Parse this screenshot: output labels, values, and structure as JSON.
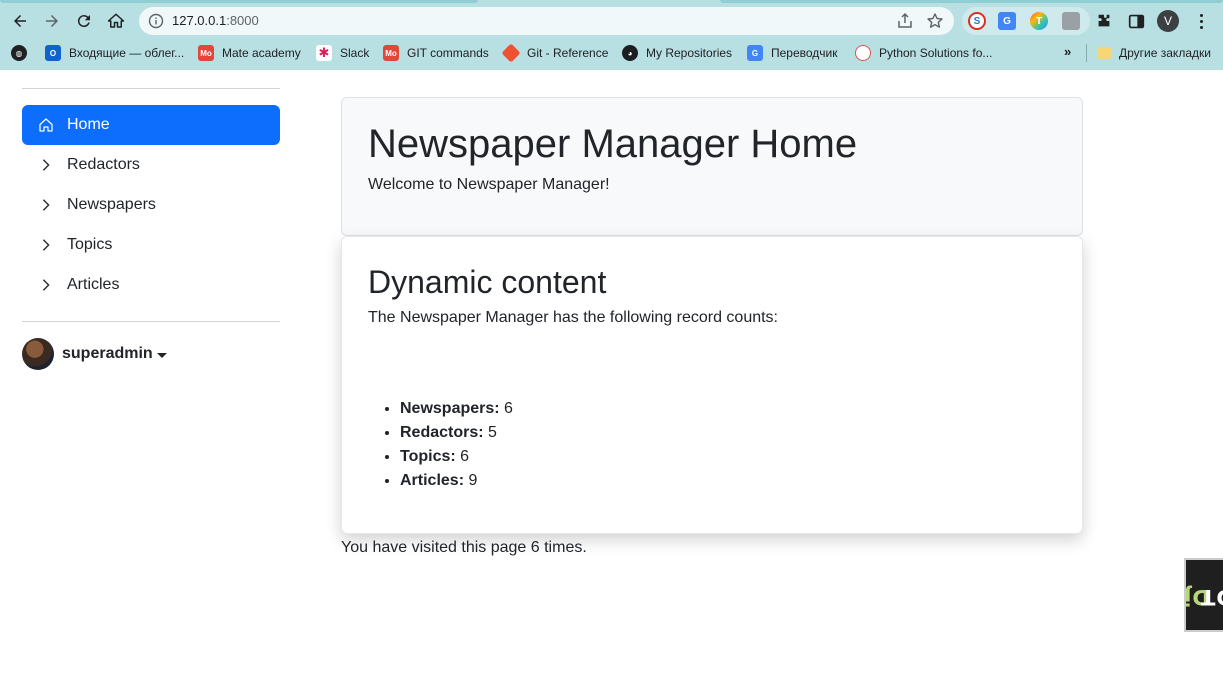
{
  "browser": {
    "url_host": "127.0.0.1",
    "url_port": ":8000",
    "profile_initial": "V",
    "bookmarks": [
      {
        "label": "Входящие — облег...",
        "icon": "outlook-icon",
        "color": "#0f64c8"
      },
      {
        "label": "Mate academy",
        "icon": "mate-academy-icon",
        "color": "#e0483c"
      },
      {
        "label": "Slack",
        "icon": "slack-icon",
        "color": "#4a154b"
      },
      {
        "label": "GIT commands",
        "icon": "git-commands-icon",
        "color": "#e0483c"
      },
      {
        "label": "Git - Reference",
        "icon": "git-icon",
        "color": "#f05133"
      },
      {
        "label": "My Repositories",
        "icon": "github-icon",
        "color": "#1b1f23"
      },
      {
        "label": "Переводчик",
        "icon": "google-translate-icon",
        "color": "#4285f4"
      },
      {
        "label": "Python Solutions fo...",
        "icon": "python-solutions-icon",
        "color": "#d9534f"
      }
    ],
    "bookmarks_more": "»",
    "other_bookmarks": "Другие закладки"
  },
  "sidebar": {
    "items": [
      {
        "label": "Home",
        "icon": "home-icon"
      },
      {
        "label": "Redactors",
        "icon": "chevron-right-icon"
      },
      {
        "label": "Newspapers",
        "icon": "chevron-right-icon"
      },
      {
        "label": "Topics",
        "icon": "chevron-right-icon"
      },
      {
        "label": "Articles",
        "icon": "chevron-right-icon"
      }
    ],
    "user": "superadmin"
  },
  "main": {
    "title": "Newspaper Manager Home",
    "welcome": "Welcome to Newspaper Manager!",
    "dynamic_title": "Dynamic content",
    "counts_intro": "The Newspaper Manager has the following record counts:",
    "counts": [
      {
        "label": "Newspapers:",
        "value": "6"
      },
      {
        "label": "Redactors:",
        "value": "5"
      },
      {
        "label": "Topics:",
        "value": "6"
      },
      {
        "label": "Articles:",
        "value": "9"
      }
    ],
    "visits": "You have visited this page 6 times."
  },
  "debug_toolbar": {
    "label_a": "Dj",
    "label_b": "DT"
  },
  "colors": {
    "accent": "#0d6efd",
    "chrome": "#b8e0e3"
  }
}
